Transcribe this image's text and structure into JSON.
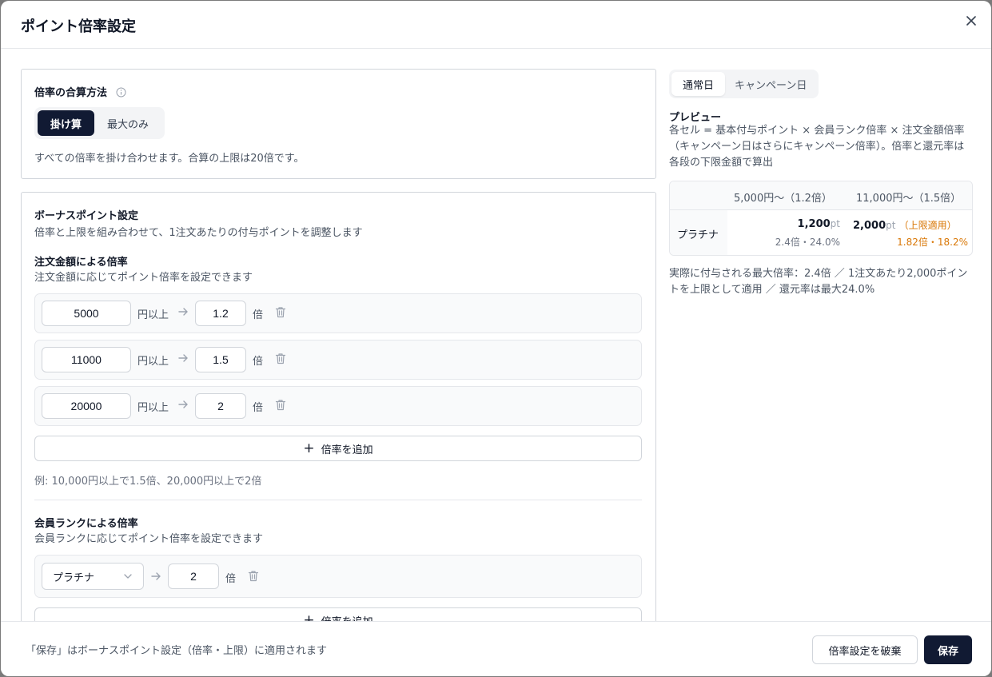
{
  "modal": {
    "title": "ポイント倍率設定"
  },
  "combine": {
    "title": "倍率の合算方法",
    "options": [
      "掛け算",
      "最大のみ"
    ],
    "selected": "掛け算",
    "description": "すべての倍率を掛け合わせます。合算の上限は20倍です。"
  },
  "bonus": {
    "title": "ボーナスポイント設定",
    "subtitle": "倍率と上限を組み合わせて、1注文あたりの付与ポイントを調整します",
    "order": {
      "title": "注文金額による倍率",
      "subtitle": "注文金額に応じてポイント倍率を設定できます",
      "rows": [
        {
          "amount": "5000",
          "unit": "円以上",
          "rate": "1.2",
          "rate_unit": "倍"
        },
        {
          "amount": "11000",
          "unit": "円以上",
          "rate": "1.5",
          "rate_unit": "倍"
        },
        {
          "amount": "20000",
          "unit": "円以上",
          "rate": "2",
          "rate_unit": "倍"
        }
      ],
      "add_label": "倍率を追加",
      "example": "例: 10,000円以上で1.5倍、20,000円以上で2倍"
    },
    "rank": {
      "title": "会員ランクによる倍率",
      "subtitle": "会員ランクに応じてポイント倍率を設定できます",
      "rows": [
        {
          "rank": "プラチナ",
          "rate": "2",
          "rate_unit": "倍"
        }
      ],
      "add_label": "倍率を追加"
    }
  },
  "preview": {
    "tabs": [
      "通常日",
      "キャンペーン日"
    ],
    "active_tab": "通常日",
    "title": "プレビュー",
    "description": "各セル = 基本付与ポイント × 会員ランク倍率 × 注文金額倍率（キャンペーン日はさらにキャンペーン倍率）。倍率と還元率は各段の下限金額で算出",
    "columns": [
      "5,000円〜（1.2倍）",
      "11,000円〜（1.5倍）"
    ],
    "rows": [
      {
        "rank": "プラチナ",
        "cells": [
          {
            "points": "1,200",
            "unit": "pt",
            "note": "",
            "detail": "2.4倍・24.0%"
          },
          {
            "points": "2,000",
            "unit": "pt",
            "note": "（上限適用）",
            "detail": "1.82倍・18.2%"
          }
        ]
      }
    ],
    "summary": "実際に付与される最大倍率：2.4倍 ／ 1注文あたり2,000ポイントを上限として適用 ／ 還元率は最大24.0%",
    "accent_color": "#d97706"
  },
  "footer": {
    "note": "「保存」はボーナスポイント設定（倍率・上限）に適用されます",
    "discard_label": "倍率設定を破棄",
    "save_label": "保存"
  }
}
